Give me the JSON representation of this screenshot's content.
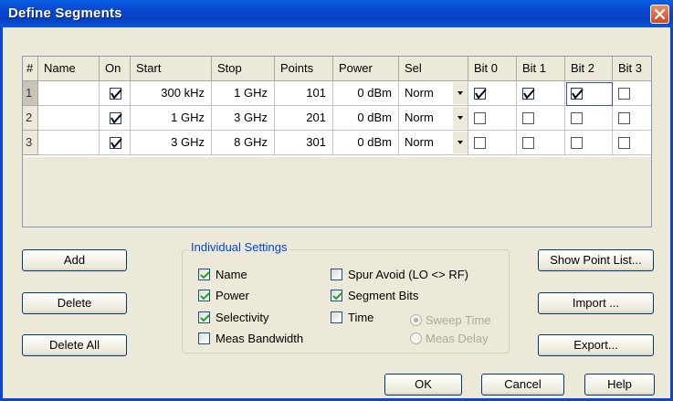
{
  "window": {
    "title": "Define Segments"
  },
  "columns": [
    "#",
    "Name",
    "On",
    "Start",
    "Stop",
    "Points",
    "Power",
    "Sel",
    "Bit 0",
    "Bit 1",
    "Bit 2",
    "Bit 3"
  ],
  "rows": [
    {
      "num": "1",
      "name": "",
      "on": true,
      "start": "300 kHz",
      "stop": "1 GHz",
      "points": "101",
      "power": "0 dBm",
      "sel": "Norm",
      "bit0": true,
      "bit1": true,
      "bit2": true,
      "bit3": false
    },
    {
      "num": "2",
      "name": "",
      "on": true,
      "start": "1 GHz",
      "stop": "3 GHz",
      "points": "201",
      "power": "0 dBm",
      "sel": "Norm",
      "bit0": false,
      "bit1": false,
      "bit2": false,
      "bit3": false
    },
    {
      "num": "3",
      "name": "",
      "on": true,
      "start": "3 GHz",
      "stop": "8 GHz",
      "points": "301",
      "power": "0 dBm",
      "sel": "Norm",
      "bit0": false,
      "bit1": false,
      "bit2": false,
      "bit3": false
    }
  ],
  "buttons": {
    "add": "Add",
    "delete": "Delete",
    "delete_all": "Delete All",
    "show_point_list": "Show Point List...",
    "import": "Import ...",
    "export": "Export...",
    "ok": "OK",
    "cancel": "Cancel",
    "help": "Help"
  },
  "individual_settings": {
    "label": "Individual Settings",
    "name": {
      "label": "Name",
      "checked": true
    },
    "power": {
      "label": "Power",
      "checked": true
    },
    "selectivity": {
      "label": "Selectivity",
      "checked": true
    },
    "meas_bandwidth": {
      "label": "Meas Bandwidth",
      "checked": false
    },
    "spur_avoid": {
      "label": "Spur Avoid (LO <> RF)",
      "checked": false
    },
    "segment_bits": {
      "label": "Segment Bits",
      "checked": true
    },
    "time": {
      "label": "Time",
      "checked": false
    },
    "sweep_time": {
      "label": "Sweep Time",
      "selected": true,
      "enabled": false
    },
    "meas_delay": {
      "label": "Meas Delay",
      "selected": false,
      "enabled": false
    }
  },
  "colors": {
    "title_bar": "#0a4fd6",
    "dialog_bg": "#ece9d8",
    "group_label": "#0046d5",
    "close_button": "#d3461f"
  }
}
